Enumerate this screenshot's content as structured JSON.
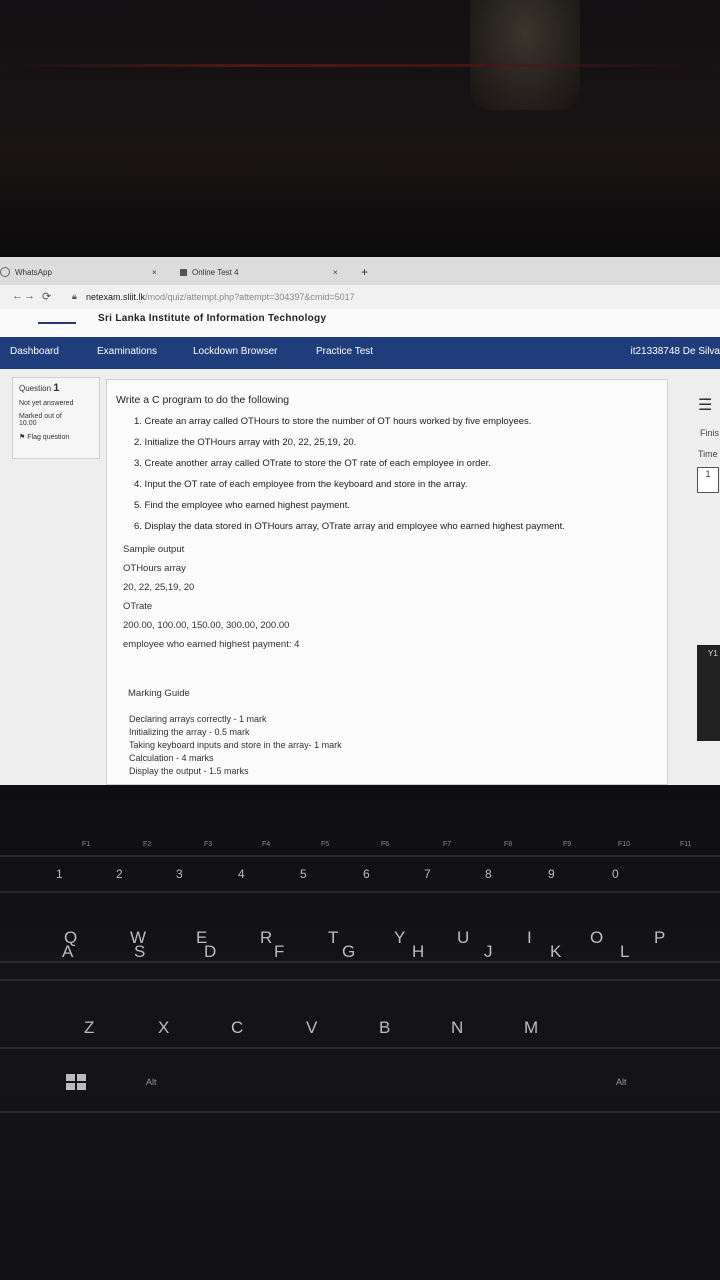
{
  "browser": {
    "tabs": [
      {
        "label": "WhatsApp"
      },
      {
        "label": "Online Test 4"
      }
    ],
    "tab_close": "×",
    "new_tab": "+",
    "url_host": "netexam.sliit.lk",
    "url_path": "/mod/quiz/attempt.php?attempt=304397&cmid=5017"
  },
  "site": {
    "name": "Sri Lanka Institute of Information Technology"
  },
  "nav": {
    "items": [
      "Dashboard",
      "Examinations",
      "Lockdown Browser",
      "Practice Test"
    ],
    "user": "it21338748 De Silva"
  },
  "question_info": {
    "label": "Question",
    "number": "1",
    "status": "Not yet answered",
    "marked_label": "Marked out of",
    "marked_value": "10.00",
    "flag": "Flag question"
  },
  "question": {
    "intro": "Write a C program to do the following",
    "tasks": [
      "1. Create an array called OTHours to store the number of OT hours worked by five employees.",
      "2. Initialize the  OTHours array with 20, 22, 25,19, 20.",
      "3. Create another array called OTrate to store the OT rate of each employee in order.",
      "4. Input the OT rate of each employee from the keyboard and store in the array.",
      "5. Find the employee who earned highest payment.",
      "6. Display the data stored in OTHours array, OTrate array and employee who earned highest payment."
    ],
    "sample_lines": [
      "Sample output",
      "OTHours array",
      "20, 22, 25,19, 20",
      "OTrate",
      "200.00, 100.00, 150.00, 300.00, 200.00",
      "employee who earned highest payment: 4"
    ],
    "guide_title": "Marking Guide",
    "guide_lines": [
      "Declaring arrays correctly - 1 mark",
      "Initializing the array - 0.5 mark",
      "Taking keyboard inputs and store in the array- 1 mark",
      "Calculation - 4 marks",
      "Display the output - 1.5 marks"
    ]
  },
  "right_panel": {
    "menu": "☰",
    "finish": "Finis",
    "time": "Time",
    "nav_number": "1",
    "side_text": "Y1"
  },
  "keyboard": {
    "number_row": [
      "1",
      "2",
      "3",
      "4",
      "5",
      "6",
      "7",
      "8",
      "9",
      "0"
    ],
    "row_q": [
      "Q",
      "W",
      "E",
      "R",
      "T",
      "Y",
      "U",
      "I",
      "O",
      "P"
    ],
    "row_a": [
      "A",
      "S",
      "D",
      "F",
      "G",
      "H",
      "J",
      "K",
      "L"
    ],
    "row_z": [
      "Z",
      "X",
      "C",
      "V",
      "B",
      "N",
      "M"
    ],
    "fkeys": [
      "F1",
      "F2",
      "F3",
      "F4",
      "F5",
      "F6",
      "F7",
      "F8",
      "F9",
      "F10",
      "F11"
    ],
    "alt_left": "Alt",
    "alt_right": "Alt"
  }
}
